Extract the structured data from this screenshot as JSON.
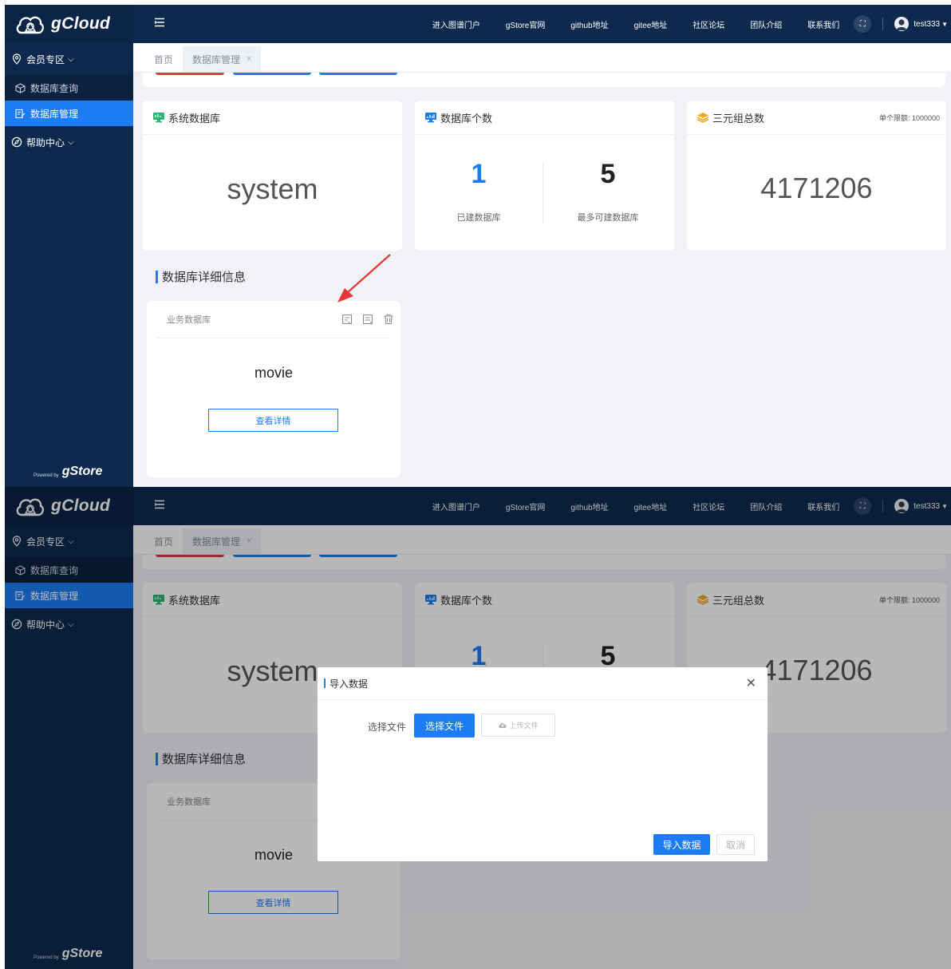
{
  "brand": {
    "name": "gCloud",
    "powered_small": "Powered by",
    "powered_name": "gStore"
  },
  "sidebar": {
    "group_member": "会员专区",
    "items": [
      {
        "label": "数据库查询"
      },
      {
        "label": "数据库管理"
      }
    ],
    "group_help": "帮助中心"
  },
  "topnav": {
    "links": [
      "进入图谱门户",
      "gStore官网",
      "github地址",
      "gitee地址",
      "社区论坛",
      "团队介绍",
      "联系我们"
    ],
    "username": "test333"
  },
  "tabs": {
    "home": "首页",
    "current": "数据库管理"
  },
  "cards": {
    "system_db": {
      "title": "系统数据库",
      "value": "system"
    },
    "db_count": {
      "title": "数据库个数",
      "built_value": "1",
      "built_label": "已建数据库",
      "max_value": "5",
      "max_label": "最多可建数据库"
    },
    "triples": {
      "title": "三元组总数",
      "limit": "单个限额: 1000000",
      "value": "4171206"
    }
  },
  "detail_section": {
    "title": "数据库详细信息",
    "card_label": "业务数据库",
    "db_name": "movie",
    "view_button": "查看详情"
  },
  "dialog": {
    "title": "导入数据",
    "file_label": "选择文件",
    "choose_button": "选择文件",
    "upload_button": "上传文件",
    "import_button": "导入数据",
    "cancel_button": "取消"
  },
  "colors": {
    "sidebar_bg": "#0d2a4e",
    "accent": "#1c7cf4",
    "danger": "#e03a3a"
  },
  "icons": {
    "brand": "gcloud-cloud-logo",
    "location": "location-pin-icon",
    "cube": "cube-icon",
    "db_manage": "database-edit-icon",
    "help": "compass-icon",
    "hamburger": "hamburger-menu-icon",
    "fullscreen": "fullscreen-icon",
    "avatar": "user-avatar",
    "monitor": "monitor-icon",
    "chart_monitor": "chart-monitor-icon",
    "layers": "layers-icon",
    "import": "import-data-icon",
    "export": "export-data-icon",
    "delete": "trash-icon",
    "cloud_upload": "cloud-upload-icon",
    "close": "close-icon"
  }
}
